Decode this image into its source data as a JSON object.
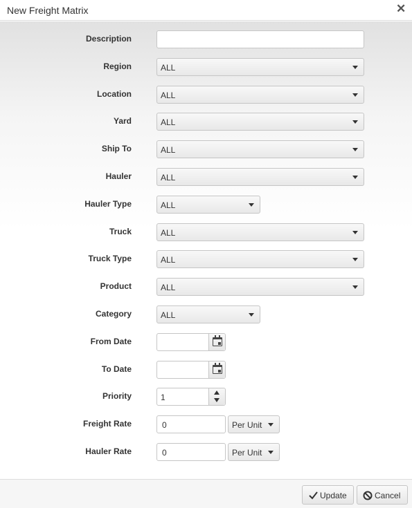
{
  "dialog": {
    "title": "New Freight Matrix",
    "close_glyph": "✕"
  },
  "form": {
    "description": {
      "label": "Description",
      "value": ""
    },
    "region": {
      "label": "Region",
      "value": "ALL"
    },
    "location": {
      "label": "Location",
      "value": "ALL"
    },
    "yard": {
      "label": "Yard",
      "value": "ALL"
    },
    "ship_to": {
      "label": "Ship To",
      "value": "ALL"
    },
    "hauler": {
      "label": "Hauler",
      "value": "ALL"
    },
    "hauler_type": {
      "label": "Hauler Type",
      "value": "ALL"
    },
    "truck": {
      "label": "Truck",
      "value": "ALL"
    },
    "truck_type": {
      "label": "Truck Type",
      "value": "ALL"
    },
    "product": {
      "label": "Product",
      "value": "ALL"
    },
    "category": {
      "label": "Category",
      "value": "ALL"
    },
    "from_date": {
      "label": "From Date",
      "value": ""
    },
    "to_date": {
      "label": "To Date",
      "value": ""
    },
    "priority": {
      "label": "Priority",
      "value": "1"
    },
    "freight_rate": {
      "label": "Freight Rate",
      "value": "0",
      "unit": "Per Unit"
    },
    "hauler_rate": {
      "label": "Hauler Rate",
      "value": "0",
      "unit": "Per Unit"
    }
  },
  "footer": {
    "update_label": "Update",
    "cancel_label": "Cancel"
  },
  "icons": {
    "update": "check-icon",
    "cancel": "ban-icon",
    "date": "calendar-icon",
    "dropdown": "chevron-down-icon"
  }
}
